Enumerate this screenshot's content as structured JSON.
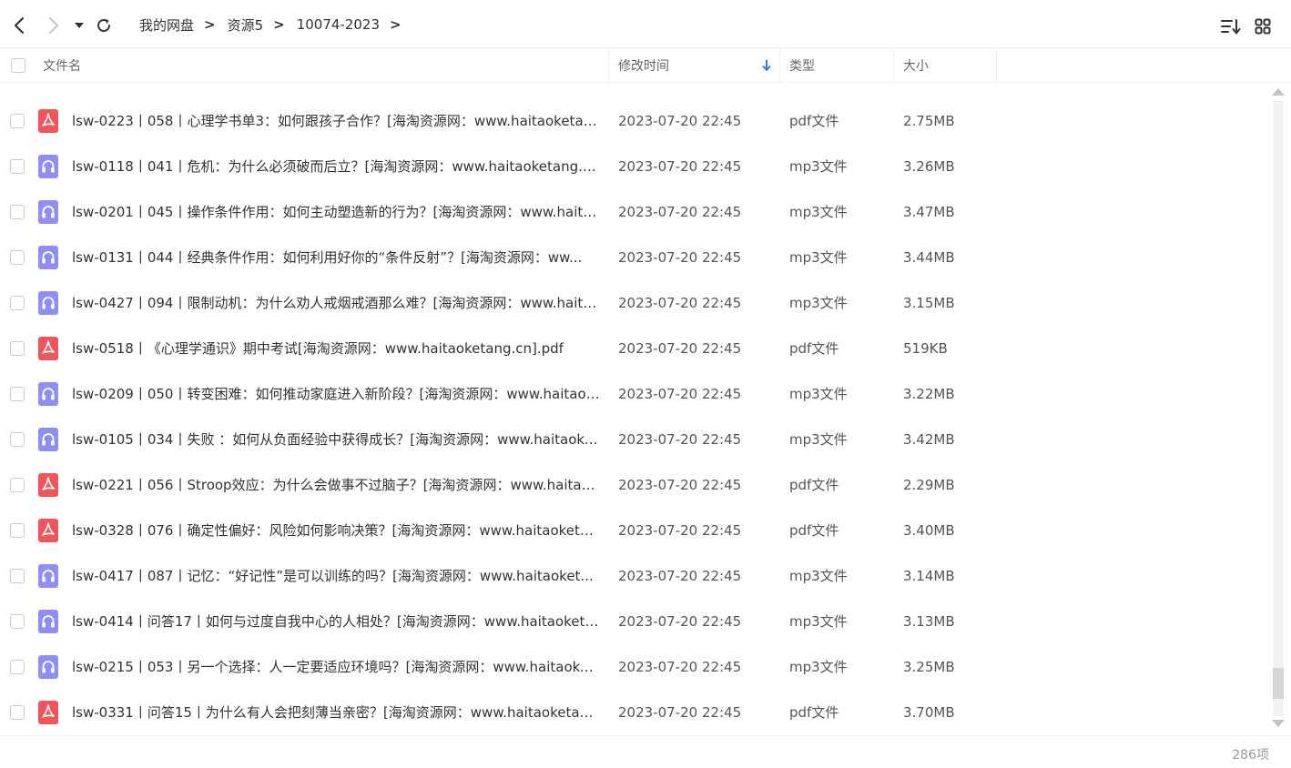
{
  "breadcrumb": {
    "items": [
      "我的网盘",
      "资源5",
      "10074-2023"
    ],
    "separator": ">"
  },
  "columns": {
    "name": "文件名",
    "modified": "修改时间",
    "type": "类型",
    "size": "大小"
  },
  "files": [
    {
      "name": "lsw-0223丨058丨心理学书单3：如何跟孩子合作？[海淘资源网：www.haitaoketan...",
      "time": "2023-07-20 22:45",
      "type": "pdf文件",
      "size": "2.75MB",
      "icon": "pdf-file-icon"
    },
    {
      "name": "lsw-0118丨041丨危机：为什么必须破而后立？[海淘资源网：www.haitaoketang.c...",
      "time": "2023-07-20 22:45",
      "type": "mp3文件",
      "size": "3.26MB",
      "icon": "audio-file-icon"
    },
    {
      "name": "lsw-0201丨045丨操作条件作用：如何主动塑造新的行为？[海淘资源网：www.haita...",
      "time": "2023-07-20 22:45",
      "type": "mp3文件",
      "size": "3.47MB",
      "icon": "audio-file-icon"
    },
    {
      "name": "lsw-0131丨044丨经典条件作用：如何利用好你的“条件反射”？[海淘资源网：ww...",
      "time": "2023-07-20 22:45",
      "type": "mp3文件",
      "size": "3.44MB",
      "icon": "audio-file-icon"
    },
    {
      "name": "lsw-0427丨094丨限制动机：为什么劝人戒烟戒酒那么难？[海淘资源网：www.haita...",
      "time": "2023-07-20 22:45",
      "type": "mp3文件",
      "size": "3.15MB",
      "icon": "audio-file-icon"
    },
    {
      "name": "lsw-0518丨《心理学通识》期中考试[海淘资源网：www.haitaoketang.cn].pdf",
      "time": "2023-07-20 22:45",
      "type": "pdf文件",
      "size": "519KB",
      "icon": "pdf-file-icon"
    },
    {
      "name": "lsw-0209丨050丨转变困难：如何推动家庭进入新阶段？[海淘资源网：www.haitaok...",
      "time": "2023-07-20 22:45",
      "type": "mp3文件",
      "size": "3.22MB",
      "icon": "audio-file-icon"
    },
    {
      "name": "lsw-0105丨034丨失败 ：如何从负面经验中获得成长？[海淘资源网：www.haitaoke...",
      "time": "2023-07-20 22:45",
      "type": "mp3文件",
      "size": "3.42MB",
      "icon": "audio-file-icon"
    },
    {
      "name": "lsw-0221丨056丨Stroop效应：为什么会做事不过脑子？[海淘资源网：www.haitao...",
      "time": "2023-07-20 22:45",
      "type": "pdf文件",
      "size": "2.29MB",
      "icon": "pdf-file-icon"
    },
    {
      "name": "lsw-0328丨076丨确定性偏好：风险如何影响决策？[海淘资源网：www.haitaoketa...",
      "time": "2023-07-20 22:45",
      "type": "pdf文件",
      "size": "3.40MB",
      "icon": "pdf-file-icon"
    },
    {
      "name": "lsw-0417丨087丨记忆：“好记性”是可以训练的吗？[海淘资源网：www.haitaoket...",
      "time": "2023-07-20 22:45",
      "type": "mp3文件",
      "size": "3.14MB",
      "icon": "audio-file-icon"
    },
    {
      "name": "lsw-0414丨问答17丨如何与过度自我中心的人相处？[海淘资源网：www.haitaoketa...",
      "time": "2023-07-20 22:45",
      "type": "mp3文件",
      "size": "3.13MB",
      "icon": "audio-file-icon"
    },
    {
      "name": "lsw-0215丨053丨另一个选择：人一定要适应环境吗？[海淘资源网：www.haitaoket...",
      "time": "2023-07-20 22:45",
      "type": "mp3文件",
      "size": "3.25MB",
      "icon": "audio-file-icon"
    },
    {
      "name": "lsw-0331丨问答15丨为什么有人会把刻薄当亲密？[海淘资源网：www.haitaoketan...",
      "time": "2023-07-20 22:45",
      "type": "pdf文件",
      "size": "3.70MB",
      "icon": "pdf-file-icon"
    }
  ],
  "footer": {
    "count": "286项"
  },
  "scroll": {
    "position_fraction": 0.97,
    "visible_fraction": 0.05
  },
  "colors": {
    "pdf": "#f0555b",
    "audio": "#8e8ef5",
    "sort_arrow": "#2f7cf6"
  },
  "icons": {
    "back": "back-arrow-icon",
    "forward": "forward-arrow-icon",
    "history": "history-dropdown-icon",
    "refresh": "refresh-icon",
    "sort": "sort-list-icon",
    "grid": "grid-view-icon",
    "sort_indicator": "sort-descending-icon"
  }
}
